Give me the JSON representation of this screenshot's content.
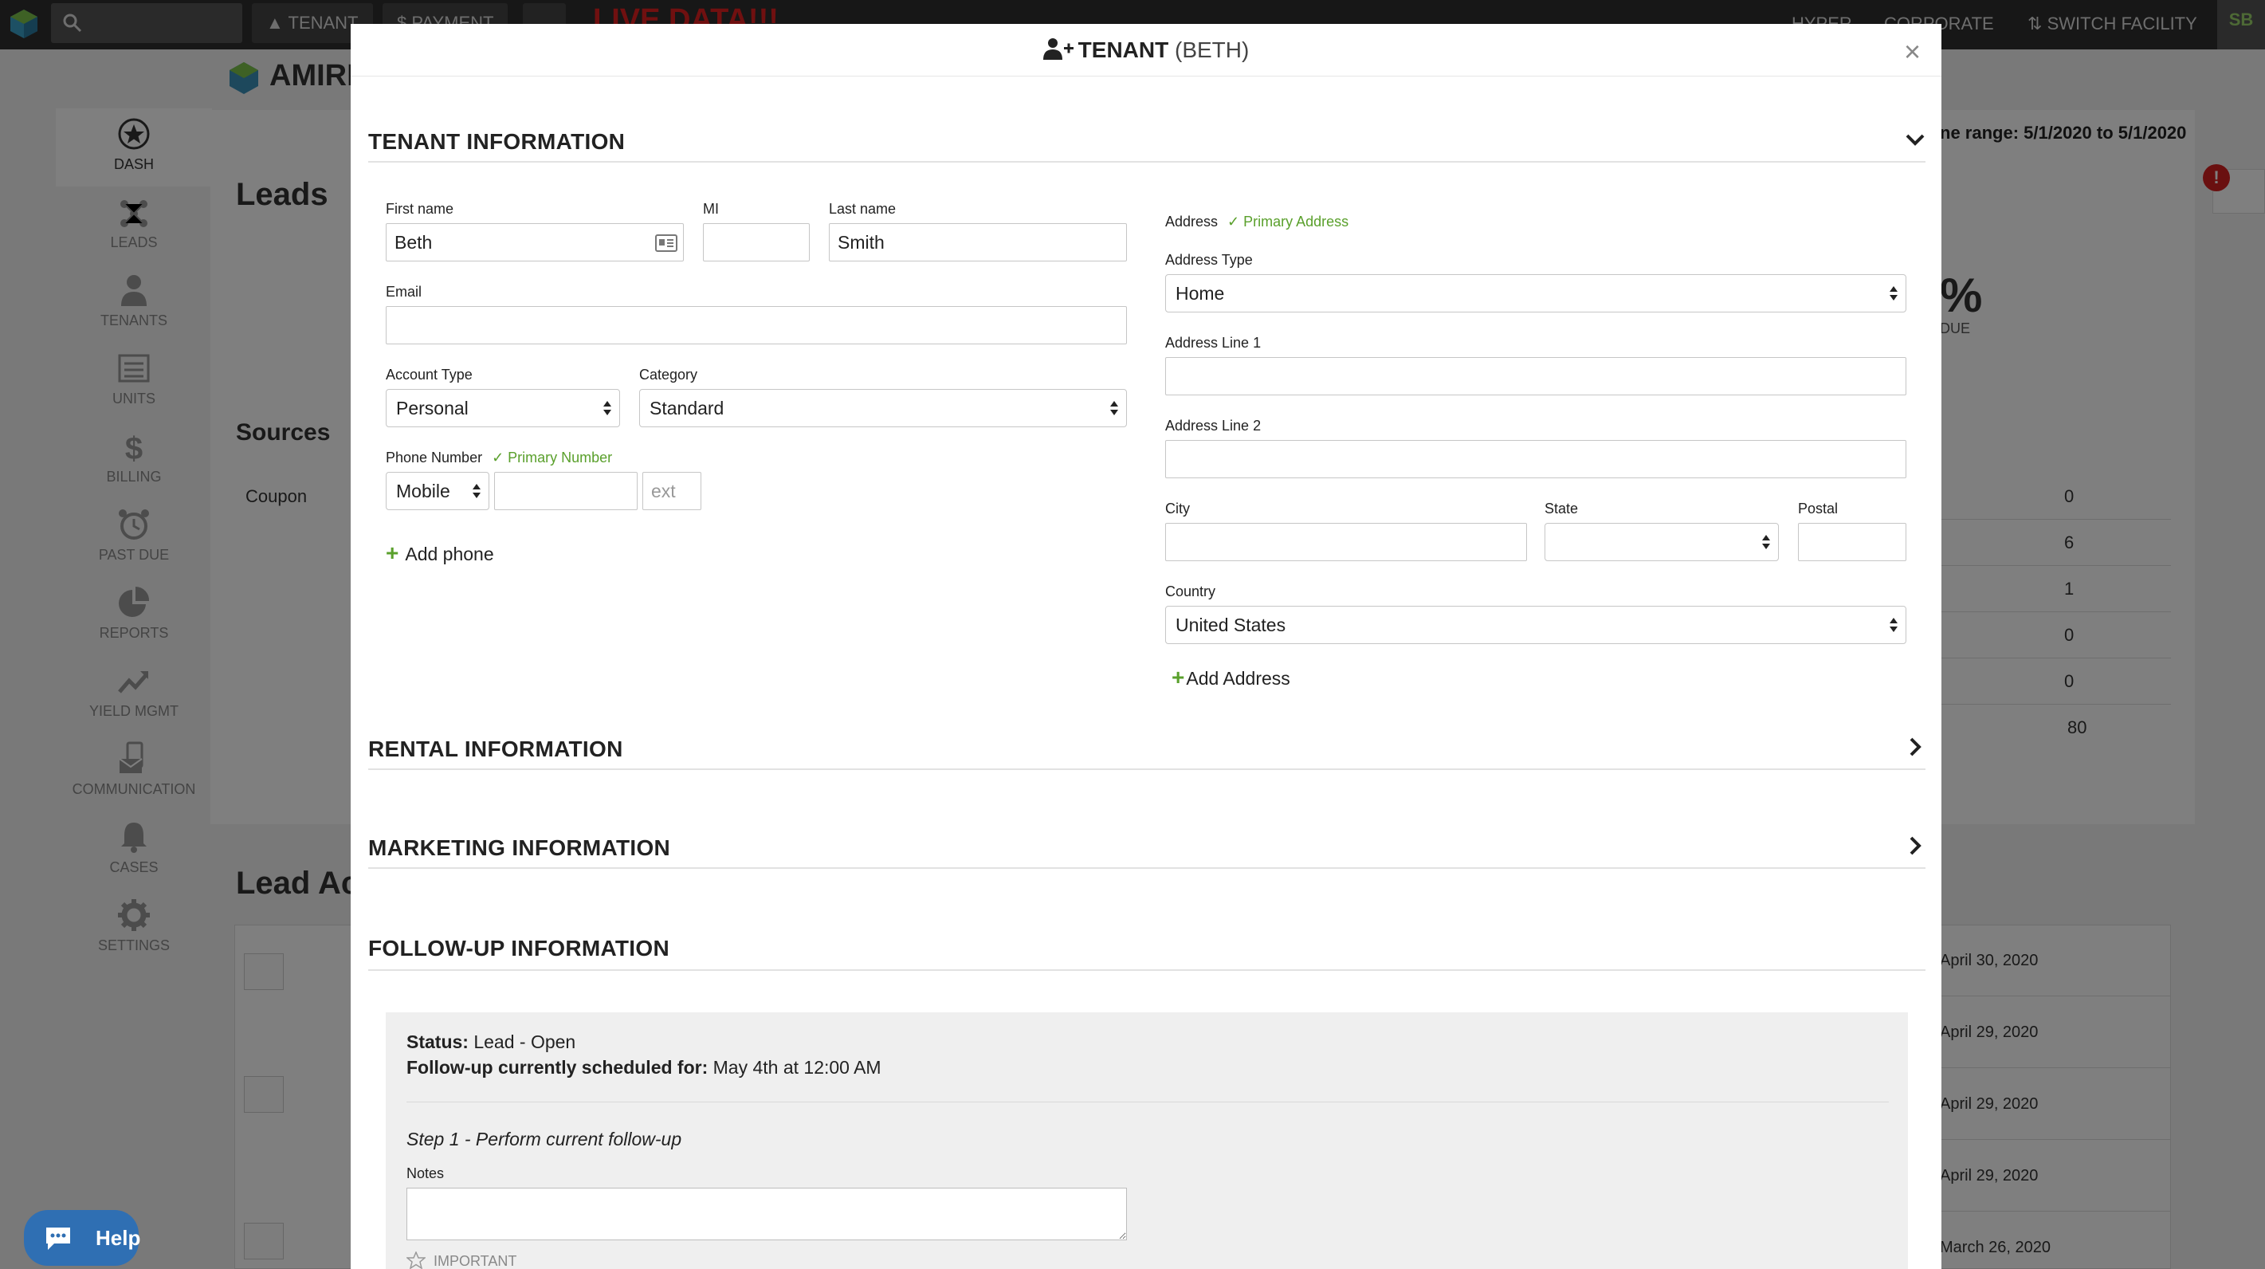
{
  "topbar": {
    "tenant_btn": "TENANT",
    "payment_btn": "PAYMENT",
    "more_btn": "...",
    "live_label": "LIVE DATA!!!",
    "hyper": "HYPER",
    "corporate": "CORPORATE",
    "switch_facility": "SWITCH FACILITY",
    "user_initials": "SB"
  },
  "brand": {
    "name": "AMIRD"
  },
  "sidebar": {
    "items": [
      {
        "label": "DASH",
        "icon": "star-badge-icon"
      },
      {
        "label": "LEADS",
        "icon": "network-icon"
      },
      {
        "label": "TENANTS",
        "icon": "person-icon"
      },
      {
        "label": "UNITS",
        "icon": "units-icon"
      },
      {
        "label": "BILLING",
        "icon": "dollar-icon"
      },
      {
        "label": "PAST DUE",
        "icon": "alarm-clock-icon"
      },
      {
        "label": "REPORTS",
        "icon": "pie-chart-icon"
      },
      {
        "label": "YIELD MGMT",
        "icon": "trend-up-icon"
      },
      {
        "label": "COMMUNICATION",
        "icon": "envelope-phone-icon"
      },
      {
        "label": "CASES",
        "icon": "bell-icon"
      },
      {
        "label": "SETTINGS",
        "icon": "gear-icon"
      }
    ]
  },
  "background": {
    "leads_title": "Leads",
    "sources_title": "Sources",
    "coupon": "Coupon",
    "lead_activity_title": "Lead Ac",
    "date_range": "ne range: 5/1/2020 to 5/1/2020",
    "pct": "%",
    "pct_label": "DUE",
    "numbers": [
      "0",
      "6",
      "1",
      "0",
      "0",
      "80"
    ],
    "activity_dates": [
      "April 30, 2020",
      "April 29, 2020",
      "April 29, 2020",
      "April 29, 2020",
      "March 26, 2020"
    ],
    "alert_count": "!"
  },
  "help": {
    "label": "Help"
  },
  "modal": {
    "title": "TENANT",
    "subtitle": "(BETH)",
    "close": "×",
    "tenant_info": {
      "heading": "TENANT INFORMATION",
      "first_name_label": "First name",
      "first_name": "Beth",
      "mi_label": "MI",
      "mi": "",
      "last_name_label": "Last name",
      "last_name": "Smith",
      "email_label": "Email",
      "email": "",
      "account_type_label": "Account Type",
      "account_type": "Personal",
      "category_label": "Category",
      "category": "Standard",
      "phone_label": "Phone Number",
      "primary_number": "✓ Primary Number",
      "phone_type": "Mobile",
      "phone": "",
      "ext_placeholder": "ext",
      "add_phone": "Add phone",
      "address_label": "Address",
      "primary_address": "✓ Primary Address",
      "address_type_label": "Address Type",
      "address_type": "Home",
      "address1_label": "Address Line 1",
      "address1": "",
      "address2_label": "Address Line 2",
      "address2": "",
      "city_label": "City",
      "city": "",
      "state_label": "State",
      "state": "",
      "postal_label": "Postal",
      "postal": "",
      "country_label": "Country",
      "country": "United States",
      "add_address": "Add Address"
    },
    "rental_info": {
      "heading": "RENTAL INFORMATION"
    },
    "marketing_info": {
      "heading": "MARKETING INFORMATION"
    },
    "followup_info": {
      "heading": "FOLLOW-UP INFORMATION",
      "status_label": "Status:",
      "status": "Lead - Open",
      "scheduled_label": "Follow-up currently scheduled for:",
      "scheduled": "May 4th at 12:00 AM",
      "step": "Step 1 - Perform current follow-up",
      "notes_label": "Notes",
      "notes": "",
      "important": "IMPORTANT"
    }
  }
}
